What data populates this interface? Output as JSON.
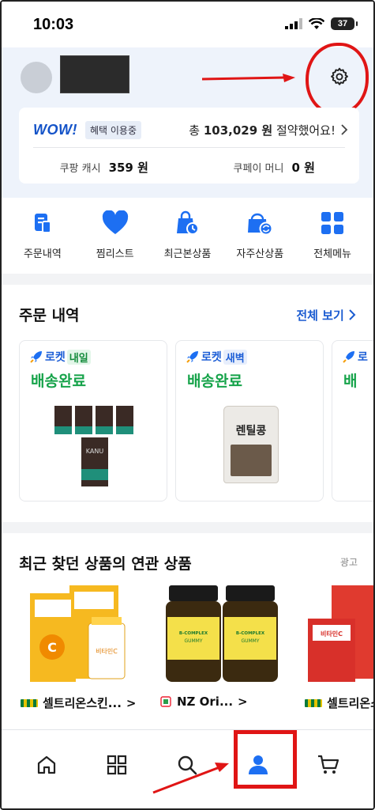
{
  "status_bar": {
    "time": "10:03",
    "battery": "37"
  },
  "wow": {
    "logo": "WOW!",
    "badge": "혜택 이용중",
    "saved_prefix": "총",
    "saved_amount": "103,029 원",
    "saved_suffix": "절약했어요!",
    "cash_label": "쿠팡 캐시",
    "cash_value": "359 원",
    "money_label": "쿠페이 머니",
    "money_value": "0 원"
  },
  "quick_menu": [
    {
      "label": "주문내역",
      "icon": "receipt-icon"
    },
    {
      "label": "찜리스트",
      "icon": "heart-icon"
    },
    {
      "label": "최근본상품",
      "icon": "recent-bag-icon"
    },
    {
      "label": "자주산상품",
      "icon": "repeat-bag-icon"
    },
    {
      "label": "전체메뉴",
      "icon": "grid-icon"
    }
  ],
  "orders": {
    "title": "주문 내역",
    "see_all": "전체 보기",
    "cards": [
      {
        "rocket": "로켓",
        "tag": "내일",
        "status": "배송완료",
        "product_image": "KANU coffee boxes"
      },
      {
        "rocket": "로켓",
        "tag": "새벽",
        "status": "배송완료",
        "product_label": "렌틸콩",
        "product_image": "lentil bag"
      },
      {
        "rocket": "로",
        "status": ""
      }
    ]
  },
  "related": {
    "title": "최근 찾던 상품의 연관 상품",
    "ad": "광고",
    "products": [
      {
        "name": "셀트리온스킨...",
        "chevron": ">",
        "image_text": "비타민C"
      },
      {
        "name": "NZ Ori...",
        "chevron": ">",
        "image_text": "ENERGY VITAMIN B-COMPLEX GUMMY"
      },
      {
        "name": "셀트리온스",
        "image_text": "비타민C"
      }
    ]
  },
  "bottom_nav": [
    {
      "icon": "home-icon"
    },
    {
      "icon": "category-grid-icon"
    },
    {
      "icon": "search-icon"
    },
    {
      "icon": "my-page-icon",
      "active": true
    },
    {
      "icon": "cart-icon"
    }
  ],
  "colors": {
    "accent": "#1a5bd1",
    "delivered": "#16a34a",
    "annotation": "#e01515"
  }
}
